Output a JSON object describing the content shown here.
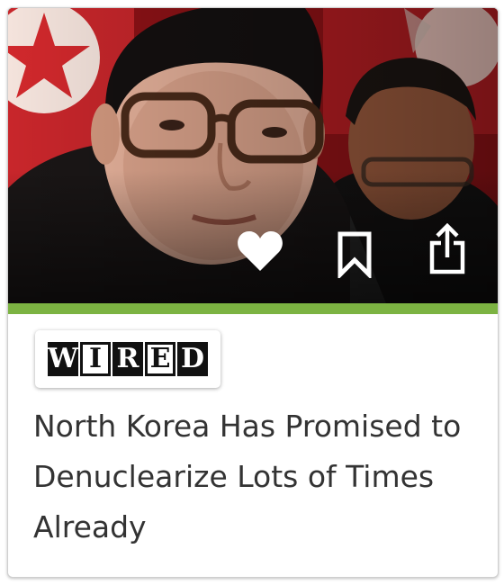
{
  "article": {
    "image_alt": "North Korean leader at an event with red flags in the background",
    "source": {
      "name": "WIRED",
      "letters": [
        "W",
        "I",
        "R",
        "E",
        "D"
      ]
    },
    "headline": "North Korea Has Promised to Denuclearize Lots of Times Already"
  },
  "actions": [
    {
      "id": "like",
      "icon": "heart-icon"
    },
    {
      "id": "bookmark",
      "icon": "bookmark-icon"
    },
    {
      "id": "share",
      "icon": "share-icon"
    }
  ],
  "colors": {
    "accent": "#7cb342",
    "headline_text": "#333333",
    "icon": "#ffffff"
  }
}
